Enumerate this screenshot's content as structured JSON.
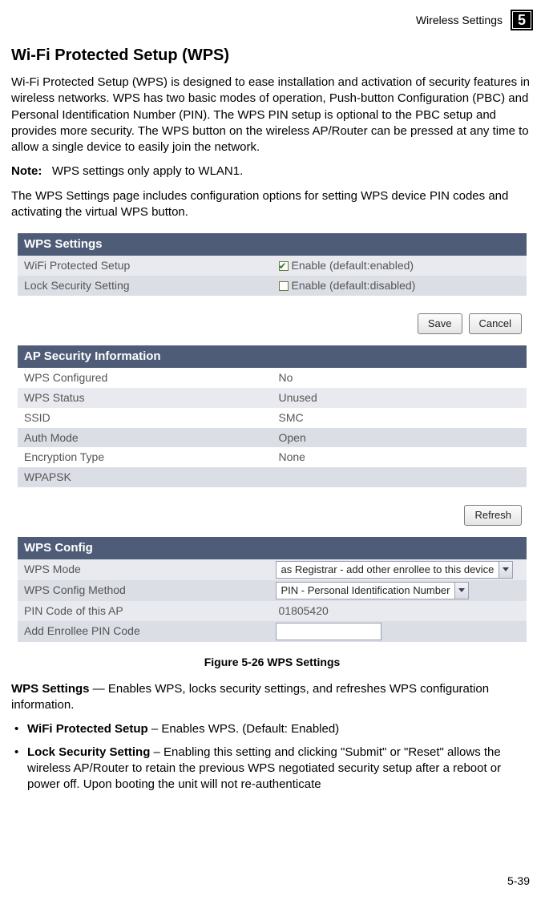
{
  "header": {
    "running_head": "Wireless Settings",
    "chapter_number": "5"
  },
  "content": {
    "section_title": "Wi-Fi Protected Setup (WPS)",
    "intro": "Wi-Fi Protected Setup (WPS) is designed to ease installation and activation of security features in wireless networks. WPS has two basic modes of operation, Push-button Configuration (PBC) and Personal Identification Number (PIN). The WPS PIN setup is optional to the PBC setup and provides more security. The WPS button on the wireless AP/Router can be pressed at any time to allow a single device to easily join the network.",
    "note_label": "Note:",
    "note_text": "WPS settings only apply to WLAN1.",
    "after_note": "The WPS Settings page includes configuration options for setting WPS device PIN codes and activating the virtual WPS button.",
    "figure_caption": "Figure 5-26  WPS Settings",
    "wps_settings_lead_bold": "WPS Settings",
    "wps_settings_lead_rest": " — Enables WPS, locks security settings, and refreshes WPS configuration information.",
    "bullets": [
      {
        "bold": "WiFi Protected Setup",
        "rest": " – Enables WPS. (Default: Enabled)"
      },
      {
        "bold": "Lock Security Setting",
        "rest": " – Enabling this setting and clicking \"Submit\" or \"Reset\" allows the wireless AP/Router to retain the previous WPS negotiated security setup after a reboot or power off. Upon booting the unit will not re-authenticate"
      }
    ]
  },
  "screenshot": {
    "panel1": {
      "title": "WPS Settings",
      "row1_label": "WiFi Protected Setup",
      "row1_value": "Enable (default:enabled)",
      "row2_label": "Lock Security Setting",
      "row2_value": "Enable (default:disabled)",
      "buttons": {
        "save": "Save",
        "cancel": "Cancel"
      }
    },
    "panel2": {
      "title": "AP Security Information",
      "rows": [
        {
          "label": "WPS Configured",
          "value": "No"
        },
        {
          "label": "WPS Status",
          "value": "Unused"
        },
        {
          "label": "SSID",
          "value": "SMC"
        },
        {
          "label": "Auth Mode",
          "value": "Open"
        },
        {
          "label": "Encryption Type",
          "value": "None"
        },
        {
          "label": "WPAPSK",
          "value": ""
        }
      ],
      "buttons": {
        "refresh": "Refresh"
      }
    },
    "panel3": {
      "title": "WPS Config",
      "row1_label": "WPS Mode",
      "row1_value": "as Registrar - add other enrollee to this device",
      "row2_label": "WPS Config Method",
      "row2_value": "PIN - Personal Identification Number",
      "row3_label": "PIN Code of this AP",
      "row3_value": "01805420",
      "row4_label": "Add Enrollee PIN Code"
    }
  },
  "footer": {
    "page_number": "5-39"
  }
}
